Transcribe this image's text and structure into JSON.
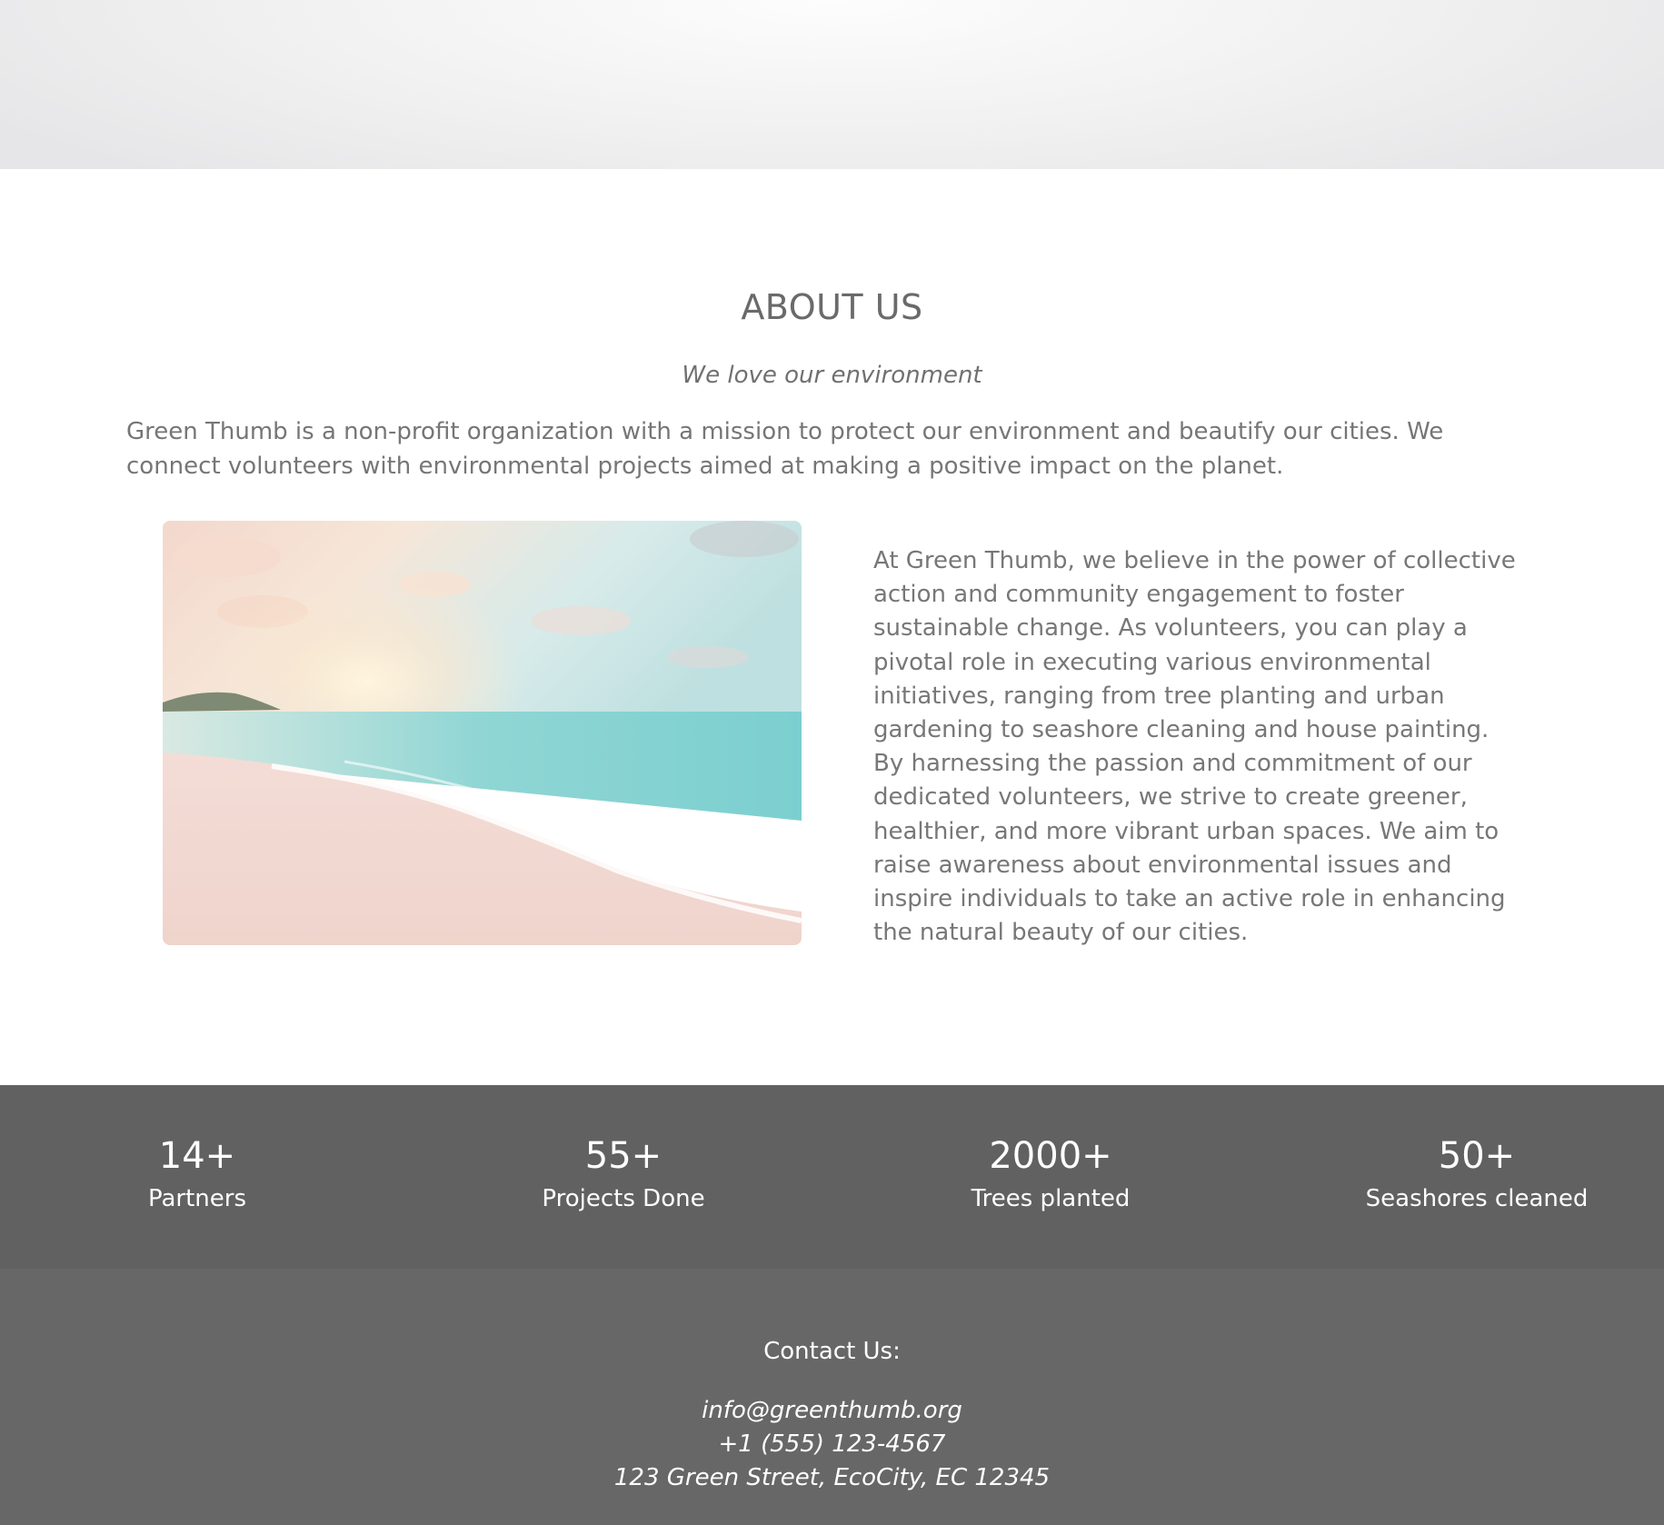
{
  "about": {
    "title": "ABOUT US",
    "subtitle": "We love our environment",
    "intro": "Green Thumb is a non-profit organization with a mission to protect our environment and beautify our cities. We connect volunteers with environmental projects aimed at making a positive impact on the planet.",
    "image_icon": "beach-sunset-photo",
    "body": "At Green Thumb, we believe in the power of collective action and community engagement to foster sustainable change. As volunteers, you can play a pivotal role in executing various environmental initiatives, ranging from tree planting and urban gardening to seashore cleaning and house painting. By harnessing the passion and commitment of our dedicated volunteers, we strive to create greener, healthier, and more vibrant urban spaces. We aim to raise awareness about environmental issues and inspire individuals to take an active role in enhancing the natural beauty of our cities."
  },
  "stats": [
    {
      "value": "14+",
      "label": "Partners"
    },
    {
      "value": "55+",
      "label": "Projects Done"
    },
    {
      "value": "2000+",
      "label": "Trees planted"
    },
    {
      "value": "50+",
      "label": "Seashores cleaned"
    }
  ],
  "contact": {
    "title": "Contact Us:",
    "email": "info@greenthumb.org",
    "phone": "+1 (555) 123-4567",
    "address": "123 Green Street, EcoCity, EC 12345"
  },
  "colors": {
    "stats_bg": "#616161",
    "footer_bg": "#676767",
    "text_muted": "#777777"
  }
}
